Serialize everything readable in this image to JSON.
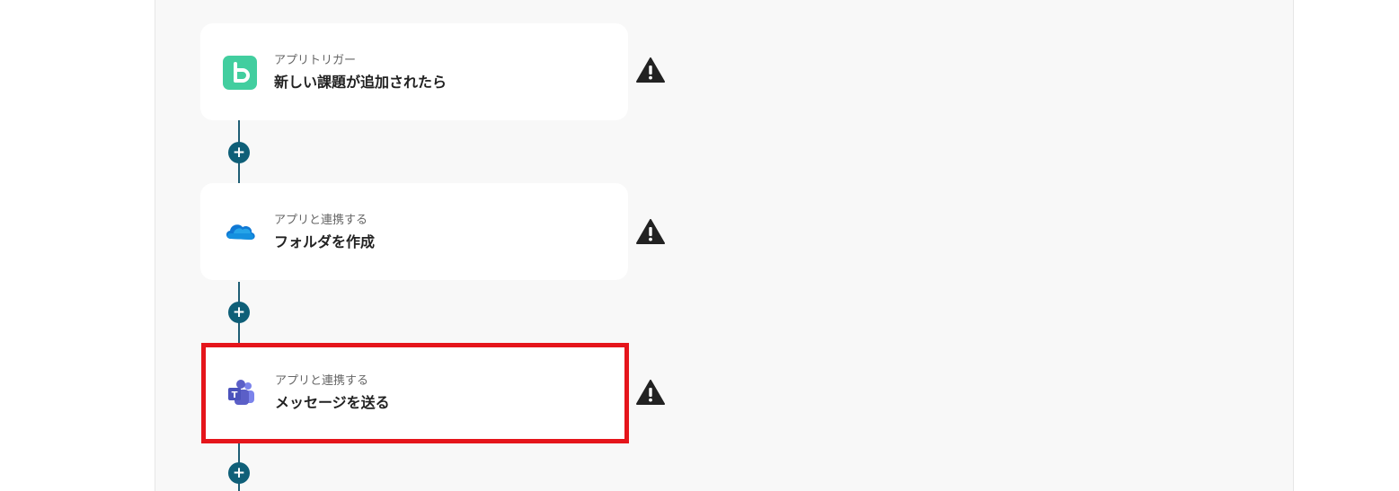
{
  "flow": {
    "steps": [
      {
        "subtitle": "アプリトリガー",
        "title": "新しい課題が追加されたら",
        "icon": "backlog-icon",
        "warning_icon": "warning-icon"
      },
      {
        "subtitle": "アプリと連携する",
        "title": "フォルダを作成",
        "icon": "onedrive-icon",
        "warning_icon": "warning-icon"
      },
      {
        "subtitle": "アプリと連携する",
        "title": "メッセージを送る",
        "icon": "teams-icon",
        "warning_icon": "warning-icon",
        "highlighted": true
      }
    ],
    "add_button_label": "+"
  },
  "colors": {
    "canvas_bg": "#f8f8f8",
    "connector": "#1f5e75",
    "add_button": "#0f5f78",
    "highlight_border": "#e5151b",
    "backlog_green": "#42ce9f",
    "onedrive_blue": "#0f78d4",
    "teams_purple": "#5b5fc7"
  }
}
